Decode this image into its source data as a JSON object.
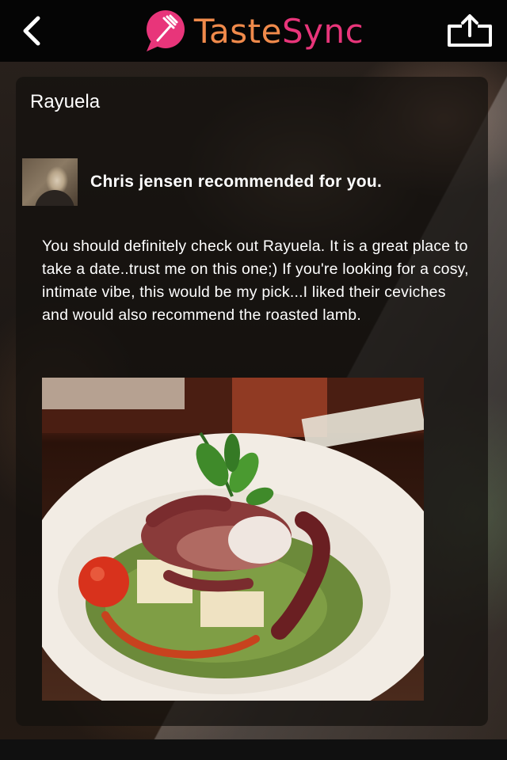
{
  "header": {
    "back_icon": "chevron-left-icon",
    "logo_text_part1": "Taste",
    "logo_text_part2": "Sync",
    "share_icon": "share-upload-icon"
  },
  "card": {
    "place_name": "Rayuela",
    "recommender_text": "Chris jensen recommended for you.",
    "review_text": "You should definitely check out Rayuela. It is a great place to take a date..trust me on this one;) If you're looking for a cosy, intimate vibe, this would be my pick...I liked their ceviches and would also recommend the roasted lamb.",
    "photo_subject": "octopus-dish-photo"
  },
  "colors": {
    "brand_pink": "#e8357a",
    "brand_orange": "#f08a4b",
    "topbar": "#050505"
  }
}
